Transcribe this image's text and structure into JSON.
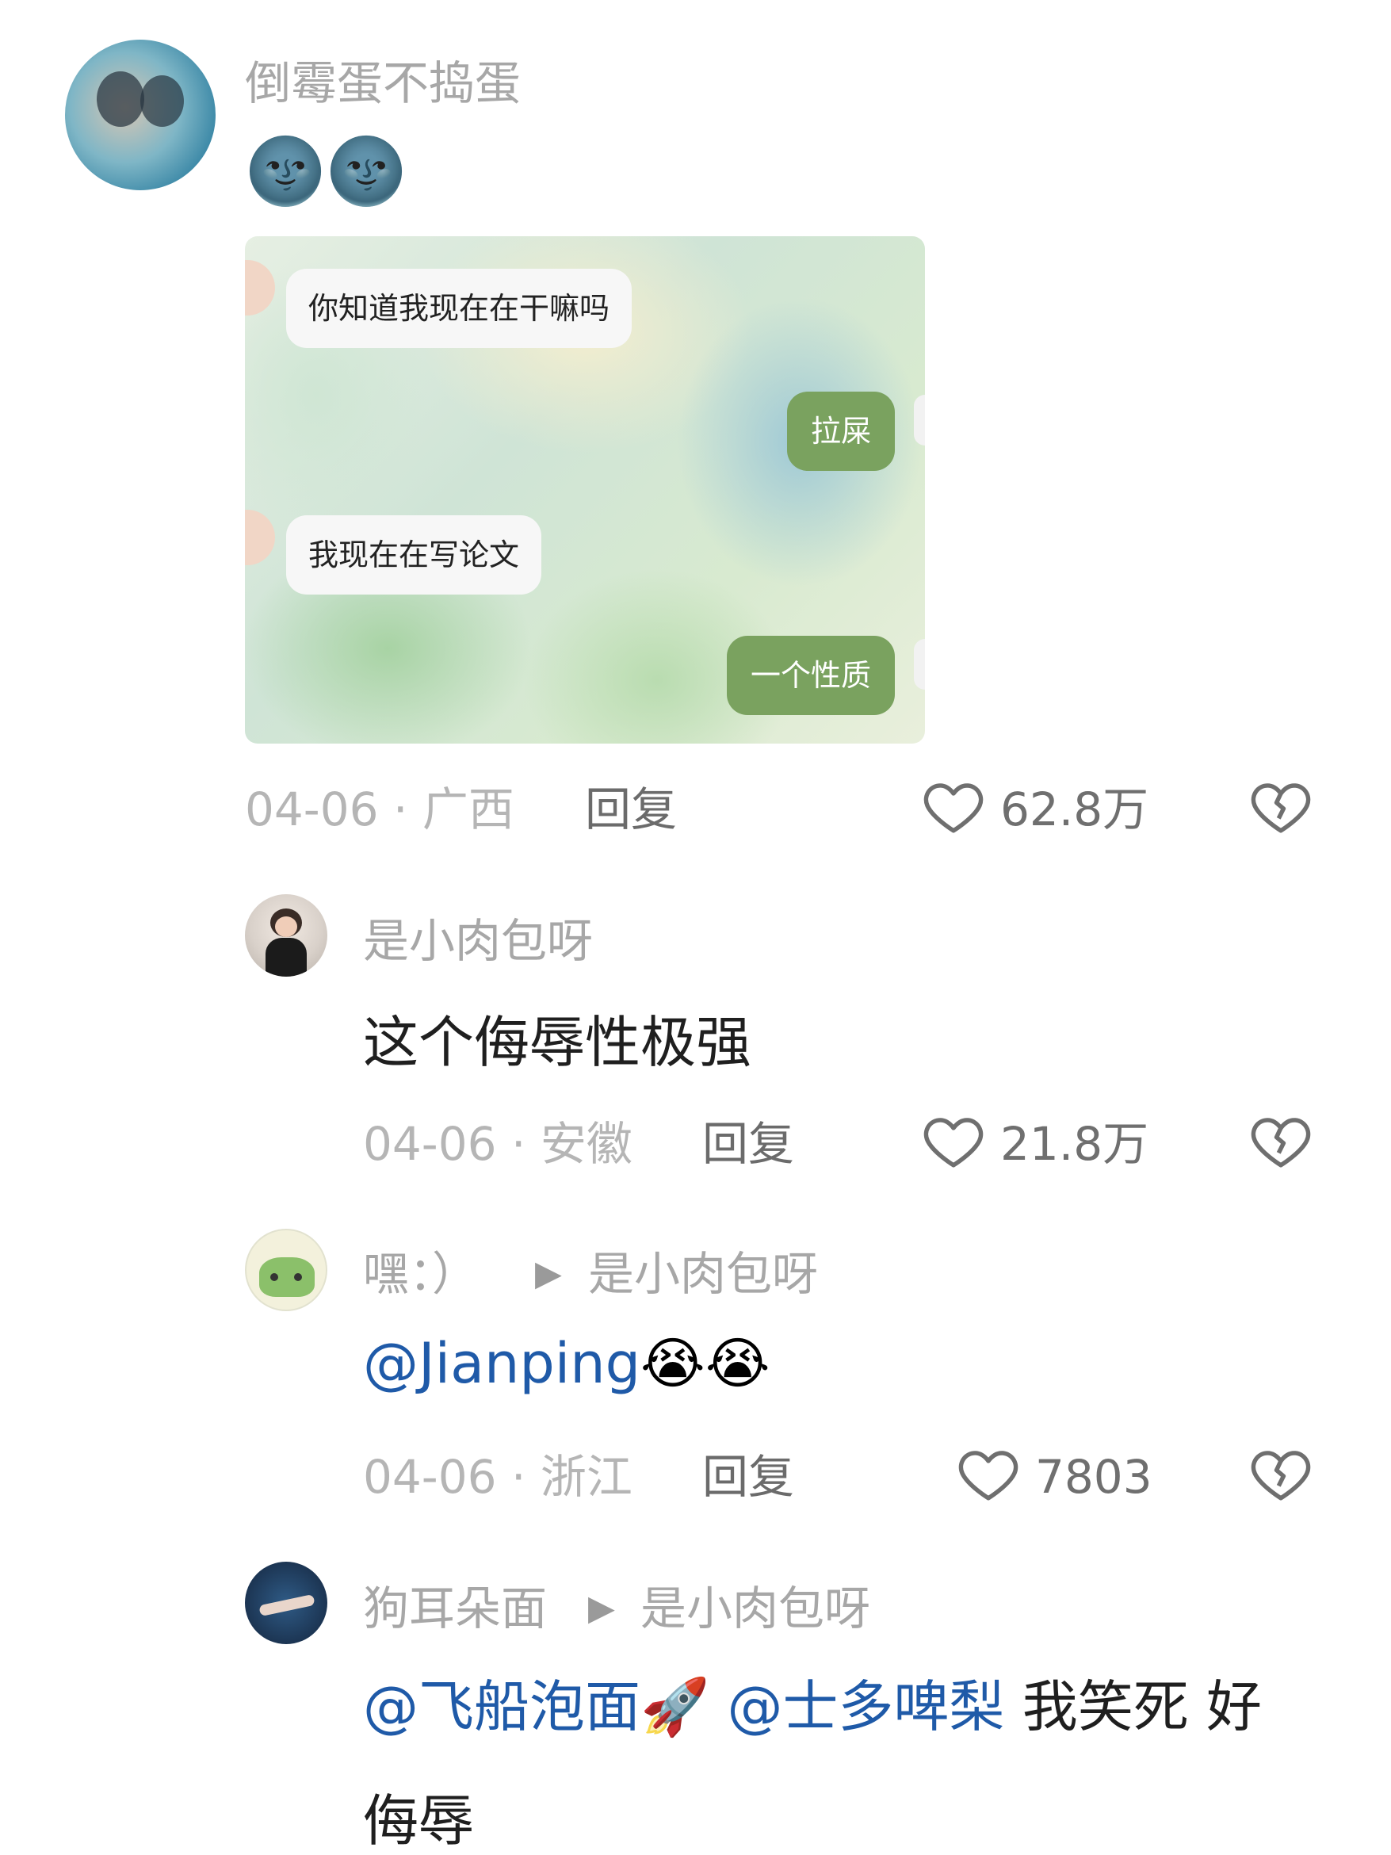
{
  "comments": [
    {
      "username": "倒霉蛋不捣蛋",
      "emojis": "🌚🌚",
      "screenshot": {
        "bubbles": [
          {
            "side": "left",
            "text": "你知道我现在在干嘛吗"
          },
          {
            "side": "right",
            "text": "拉屎"
          },
          {
            "side": "left",
            "text": "我现在在写论文"
          },
          {
            "side": "right",
            "text": "一个性质"
          }
        ]
      },
      "date": "04-06",
      "location": "广西",
      "meta": "04-06 · 广西",
      "reply_label": "回复",
      "likes": "62.8万"
    },
    {
      "username": "是小肉包呀",
      "text": "这个侮辱性极强",
      "meta": "04-06 · 安徽",
      "reply_label": "回复",
      "likes": "21.8万"
    },
    {
      "username": "嘿：）",
      "reply_to": "是小肉包呀",
      "mention": "@Jianping",
      "emojis": "😭😭",
      "meta": "04-06 · 浙江",
      "reply_label": "回复",
      "likes": "7803"
    },
    {
      "username": "狗耳朵面",
      "reply_to": "是小肉包呀",
      "mention1": "@飞船泡面🚀",
      "mention2": "@士多啤梨",
      "text_line1": "我笑死 好",
      "text_line2": "侮辱"
    }
  ],
  "colors": {
    "mention": "#1f5aa8",
    "bubble_green": "#7aa25f",
    "meta_gray": "#b5b5b5"
  }
}
